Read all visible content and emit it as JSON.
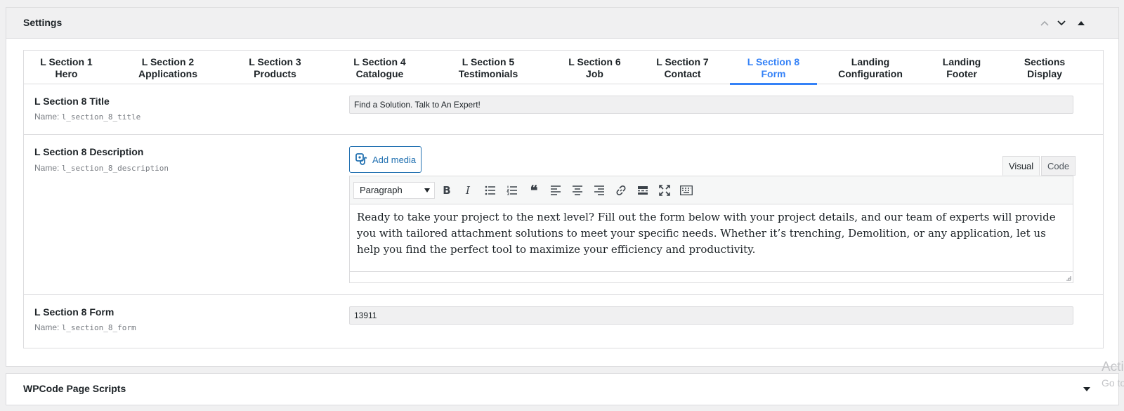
{
  "settings_panel": {
    "title": "Settings"
  },
  "tabs": [
    {
      "line1": "L Section 1",
      "line2": "Hero"
    },
    {
      "line1": "L Section 2",
      "line2": "Applications"
    },
    {
      "line1": "L Section 3",
      "line2": "Products"
    },
    {
      "line1": "L Section 4",
      "line2": "Catalogue"
    },
    {
      "line1": "L Section 5",
      "line2": "Testimonials"
    },
    {
      "line1": "L Section 6",
      "line2": "Job"
    },
    {
      "line1": "L Section 7",
      "line2": "Contact"
    },
    {
      "line1": "L Section 8",
      "line2": "Form"
    },
    {
      "line1": "Landing",
      "line2": "Configuration"
    },
    {
      "line1": "Landing",
      "line2": "Footer"
    },
    {
      "line1": "Sections",
      "line2": "Display"
    }
  ],
  "active_tab": "L Section 8 Form",
  "fields": {
    "title": {
      "label": "L Section 8 Title",
      "name_prefix": "Name:",
      "name": "l_section_8_title",
      "value": "Find a Solution. Talk to An Expert!"
    },
    "description": {
      "label": "L Section 8 Description",
      "name_prefix": "Name:",
      "name": "l_section_8_description",
      "add_media_label": "Add media",
      "mode_visual": "Visual",
      "mode_code": "Code",
      "format_value": "Paragraph",
      "content": "Ready to take your project to the next level? Fill out the form below with your project details, and our team of experts will provide you with tailored attachment solutions to meet your specific needs. Whether it’s trenching, Demolition, or any application, let us help you find the perfect tool to maximize your efficiency and productivity."
    },
    "form": {
      "label": "L Section 8 Form",
      "name_prefix": "Name:",
      "name": "l_section_8_form",
      "value": "13911"
    }
  },
  "toolbar_icons": [
    "bold-icon",
    "italic-icon",
    "bullet-list-icon",
    "numbered-list-icon",
    "blockquote-icon",
    "align-left-icon",
    "align-center-icon",
    "align-right-icon",
    "link-icon",
    "read-more-icon",
    "fullscreen-icon",
    "toolbar-toggle-icon"
  ],
  "wpcode_panel": {
    "title": "WPCode Page Scripts"
  },
  "watermark": {
    "line1": "Acti",
    "line2": "Go to"
  },
  "colors": {
    "accent": "#3582f7",
    "link_blue": "#2271b1",
    "border": "#dcdcde"
  }
}
